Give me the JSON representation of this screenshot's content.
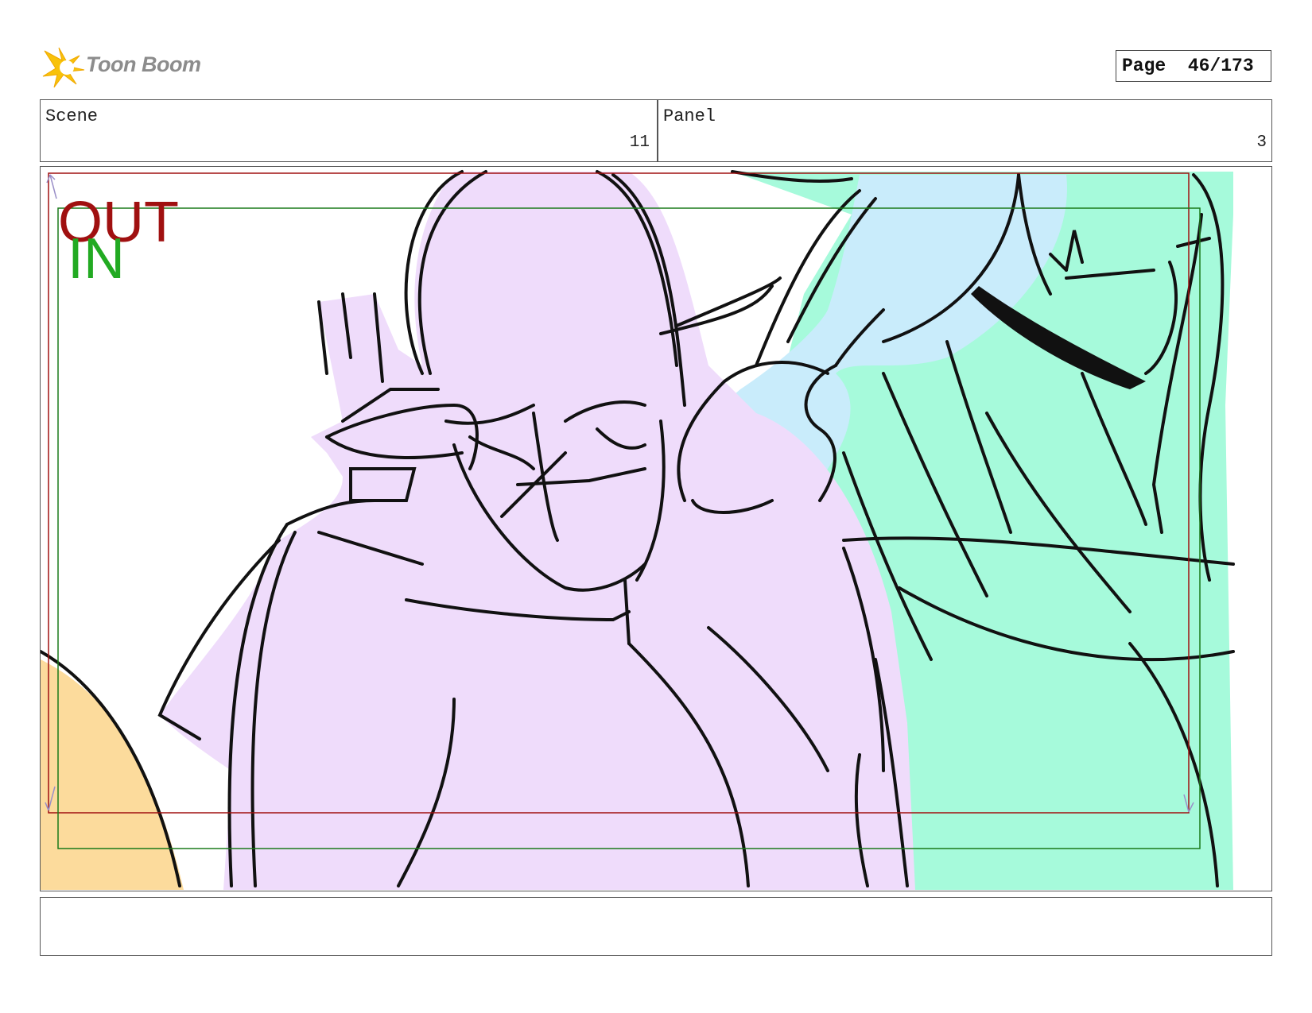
{
  "header": {
    "logo_text": "Toon Boom",
    "page_label": "Page",
    "page_value": "46/173"
  },
  "scene": {
    "label": "Scene",
    "value": "11"
  },
  "panel": {
    "label": "Panel",
    "value": "3"
  },
  "frame": {
    "out_label": "OUT",
    "in_label": "IN",
    "colors": {
      "out_frame": "#a01010",
      "in_frame": "#1a7a1a",
      "in_text": "#22aa22",
      "character_purple": "#efdcfb",
      "character_green": "#a6fadb",
      "character_blue": "#c9ecfb",
      "foreground_orange": "#fcdb9c"
    }
  },
  "notes": {
    "text": ""
  }
}
